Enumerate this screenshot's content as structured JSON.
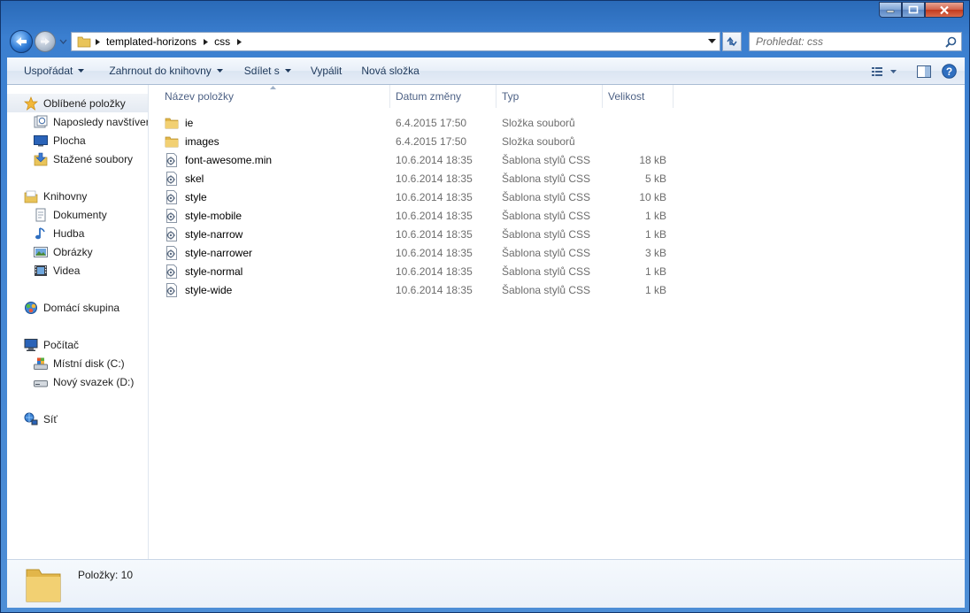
{
  "window": {
    "caption_buttons": [
      "minimize-icon",
      "maximize-icon",
      "close-icon"
    ]
  },
  "address_bar": {
    "breadcrumbs": [
      "templated-horizons",
      "css"
    ]
  },
  "search": {
    "placeholder": "Prohledat: css"
  },
  "toolbar": {
    "organize": "Uspořádat",
    "include_in_library": "Zahrnout do knihovny",
    "share_with": "Sdílet s",
    "burn": "Vypálit",
    "new_folder": "Nová složka",
    "right_icons": [
      "view-icon",
      "preview-pane-icon",
      "help-icon"
    ]
  },
  "nav_pane": {
    "favorites": {
      "label": "Oblíbené položky",
      "items": [
        "Naposledy navštíver",
        "Plocha",
        "Stažené soubory"
      ]
    },
    "libraries": {
      "label": "Knihovny",
      "items": [
        "Dokumenty",
        "Hudba",
        "Obrázky",
        "Videa"
      ]
    },
    "homegroup": {
      "label": "Domácí skupina"
    },
    "computer": {
      "label": "Počítač",
      "items": [
        "Místní disk (C:)",
        "Nový svazek (D:)"
      ]
    },
    "network": {
      "label": "Síť"
    }
  },
  "columns": {
    "name": "Název položky",
    "date": "Datum změny",
    "type": "Typ",
    "size": "Velikost"
  },
  "files": [
    {
      "name": "ie",
      "date": "6.4.2015 17:50",
      "type": "Složka souborů",
      "size": "",
      "kind": "folder"
    },
    {
      "name": "images",
      "date": "6.4.2015 17:50",
      "type": "Složka souborů",
      "size": "",
      "kind": "folder"
    },
    {
      "name": "font-awesome.min",
      "date": "10.6.2014 18:35",
      "type": "Šablona stylů CSS",
      "size": "18 kB",
      "kind": "css"
    },
    {
      "name": "skel",
      "date": "10.6.2014 18:35",
      "type": "Šablona stylů CSS",
      "size": "5 kB",
      "kind": "css"
    },
    {
      "name": "style",
      "date": "10.6.2014 18:35",
      "type": "Šablona stylů CSS",
      "size": "10 kB",
      "kind": "css"
    },
    {
      "name": "style-mobile",
      "date": "10.6.2014 18:35",
      "type": "Šablona stylů CSS",
      "size": "1 kB",
      "kind": "css"
    },
    {
      "name": "style-narrow",
      "date": "10.6.2014 18:35",
      "type": "Šablona stylů CSS",
      "size": "1 kB",
      "kind": "css"
    },
    {
      "name": "style-narrower",
      "date": "10.6.2014 18:35",
      "type": "Šablona stylů CSS",
      "size": "3 kB",
      "kind": "css"
    },
    {
      "name": "style-normal",
      "date": "10.6.2014 18:35",
      "type": "Šablona stylů CSS",
      "size": "1 kB",
      "kind": "css"
    },
    {
      "name": "style-wide",
      "date": "10.6.2014 18:35",
      "type": "Šablona stylů CSS",
      "size": "1 kB",
      "kind": "css"
    }
  ],
  "status": {
    "item_count": "Položky: 10"
  },
  "colors": {
    "frame": "#3b7fd0",
    "toolbar_text": "#1e395b",
    "column_header_text": "#4d6185",
    "secondary_text": "#6d6d6d"
  }
}
